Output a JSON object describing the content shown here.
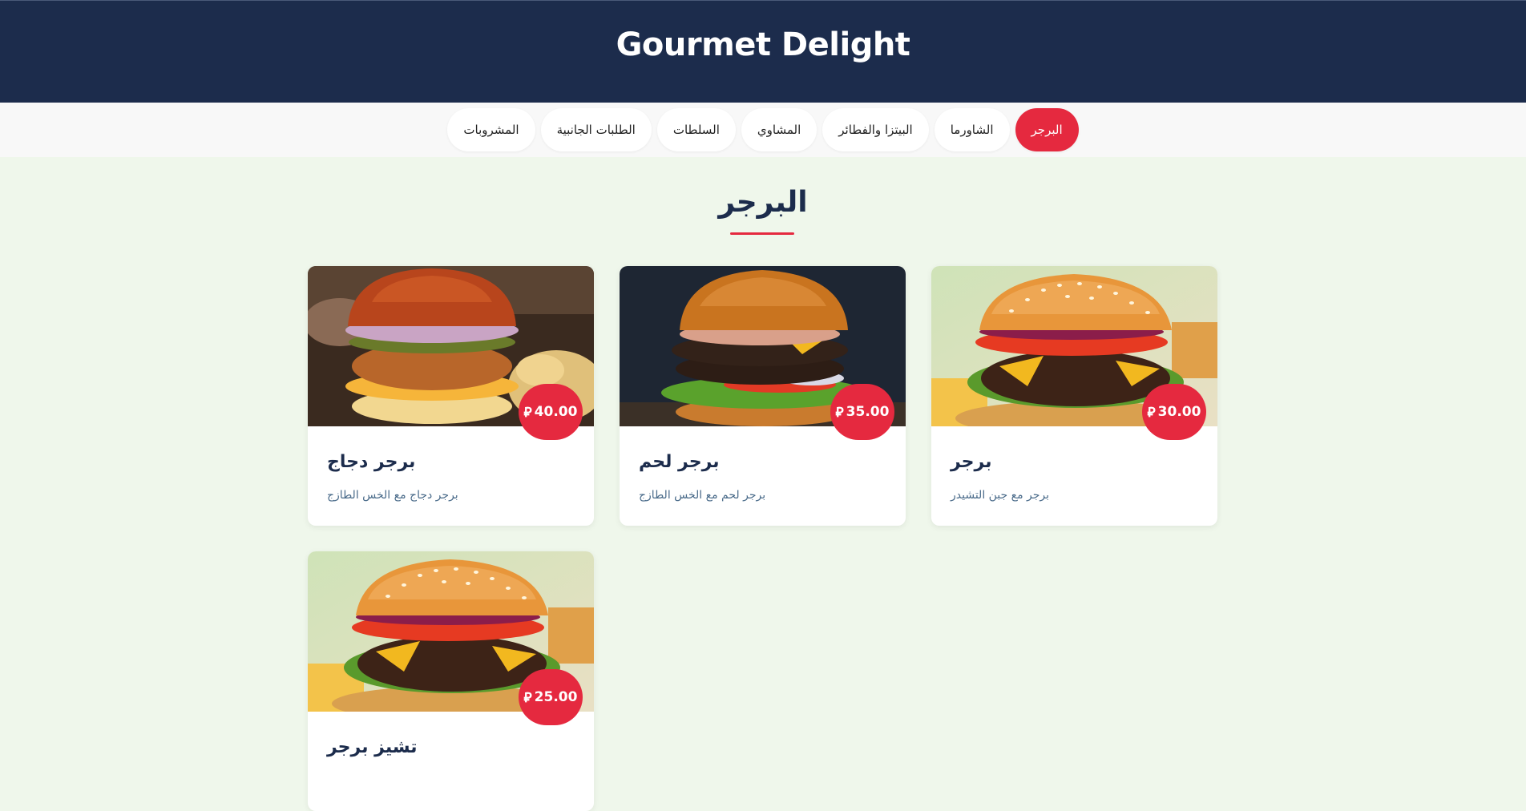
{
  "brand": "Gourmet Delight",
  "nav": {
    "tabs": [
      "البرجر",
      "الشاورما",
      "البيتزا والفطائر",
      "المشاوي",
      "السلطات",
      "الطلبات الجانبية",
      "المشروبات"
    ],
    "active": "البرجر"
  },
  "section": {
    "title": "البرجر"
  },
  "currency_icon": "saudi-riyal-icon",
  "colors": {
    "header": "#1c2c4c",
    "accent": "#e5293f",
    "background": "#eff7eb"
  },
  "items": [
    {
      "name": "برجر",
      "description": "برجر مع جبن التشيدر",
      "price": "30.00"
    },
    {
      "name": "برجر لحم",
      "description": "برجر لحم مع الخس الطازج",
      "price": "35.00"
    },
    {
      "name": "برجر دجاج",
      "description": "برجر دجاج مع الخس الطازج",
      "price": "40.00"
    },
    {
      "name": "تشيز برجر",
      "description": "",
      "price": "25.00"
    }
  ]
}
